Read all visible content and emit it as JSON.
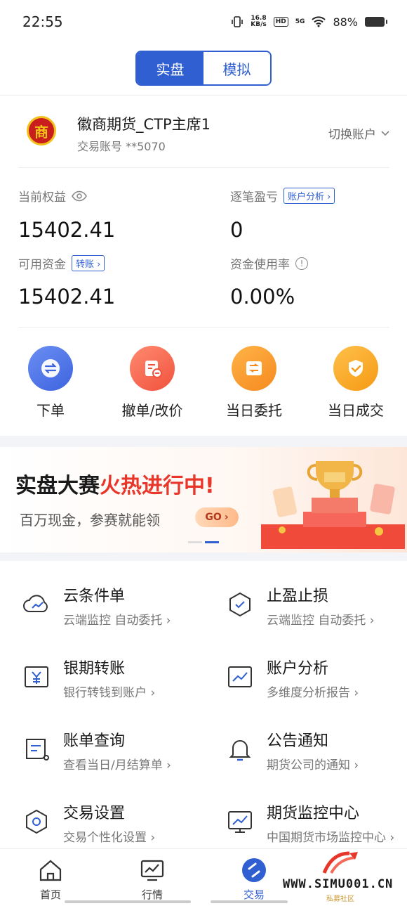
{
  "status": {
    "time": "22:55",
    "net_speed_top": "16.8",
    "net_speed_bottom": "KB/s",
    "hd": "HD",
    "signal": "5G",
    "battery": "88%"
  },
  "mode_tabs": {
    "real": "实盘",
    "sim": "模拟"
  },
  "account": {
    "name": "徽商期货_CTP主席1",
    "number": "交易账号 **5070",
    "switch": "切换账户",
    "logo_char": "商"
  },
  "balance": {
    "equity_label": "当前权益",
    "equity_value": "15402.41",
    "pnl_label": "逐笔盈亏",
    "pnl_tag": "账户分析",
    "pnl_value": "0",
    "available_label": "可用资金",
    "available_tag": "转账",
    "available_value": "15402.41",
    "usage_label": "资金使用率",
    "usage_value": "0.00%"
  },
  "quick_actions": [
    {
      "label": "下单",
      "icon": "exchange-icon",
      "color": "#4a72e8"
    },
    {
      "label": "撤单/改价",
      "icon": "cancel-order-icon",
      "color": "#f0604a"
    },
    {
      "label": "当日委托",
      "icon": "entrust-icon",
      "color": "#f7951f"
    },
    {
      "label": "当日成交",
      "icon": "check-shield-icon",
      "color": "#f7a21f"
    }
  ],
  "banner": {
    "title_a": "实盘大赛",
    "title_b": "火热进行中!",
    "subtitle": "百万现金，参赛就能领",
    "go": "GO"
  },
  "menu": [
    {
      "title": "云条件单",
      "sub": "云端监控 自动委托",
      "icon": "cloud-icon"
    },
    {
      "title": "止盈止损",
      "sub": "云端监控 自动委托",
      "icon": "shield-check-icon"
    },
    {
      "title": "银期转账",
      "sub": "银行转钱到账户",
      "icon": "yen-transfer-icon"
    },
    {
      "title": "账户分析",
      "sub": "多维度分析报告",
      "icon": "chart-icon"
    },
    {
      "title": "账单查询",
      "sub": "查看当日/月结算单",
      "icon": "bill-icon"
    },
    {
      "title": "公告通知",
      "sub": "期货公司的通知",
      "icon": "bell-icon"
    },
    {
      "title": "交易设置",
      "sub": "交易个性化设置",
      "icon": "settings-hex-icon"
    },
    {
      "title": "期货监控中心",
      "sub": "中国期货市场监控中心",
      "icon": "monitor-icon"
    }
  ],
  "nav": [
    {
      "label": "首页",
      "icon": "home-icon"
    },
    {
      "label": "行情",
      "icon": "market-icon"
    },
    {
      "label": "交易",
      "icon": "trade-icon"
    }
  ],
  "watermark": {
    "site": "WWW.SIMU001.CN",
    "sub": "私募社区"
  }
}
